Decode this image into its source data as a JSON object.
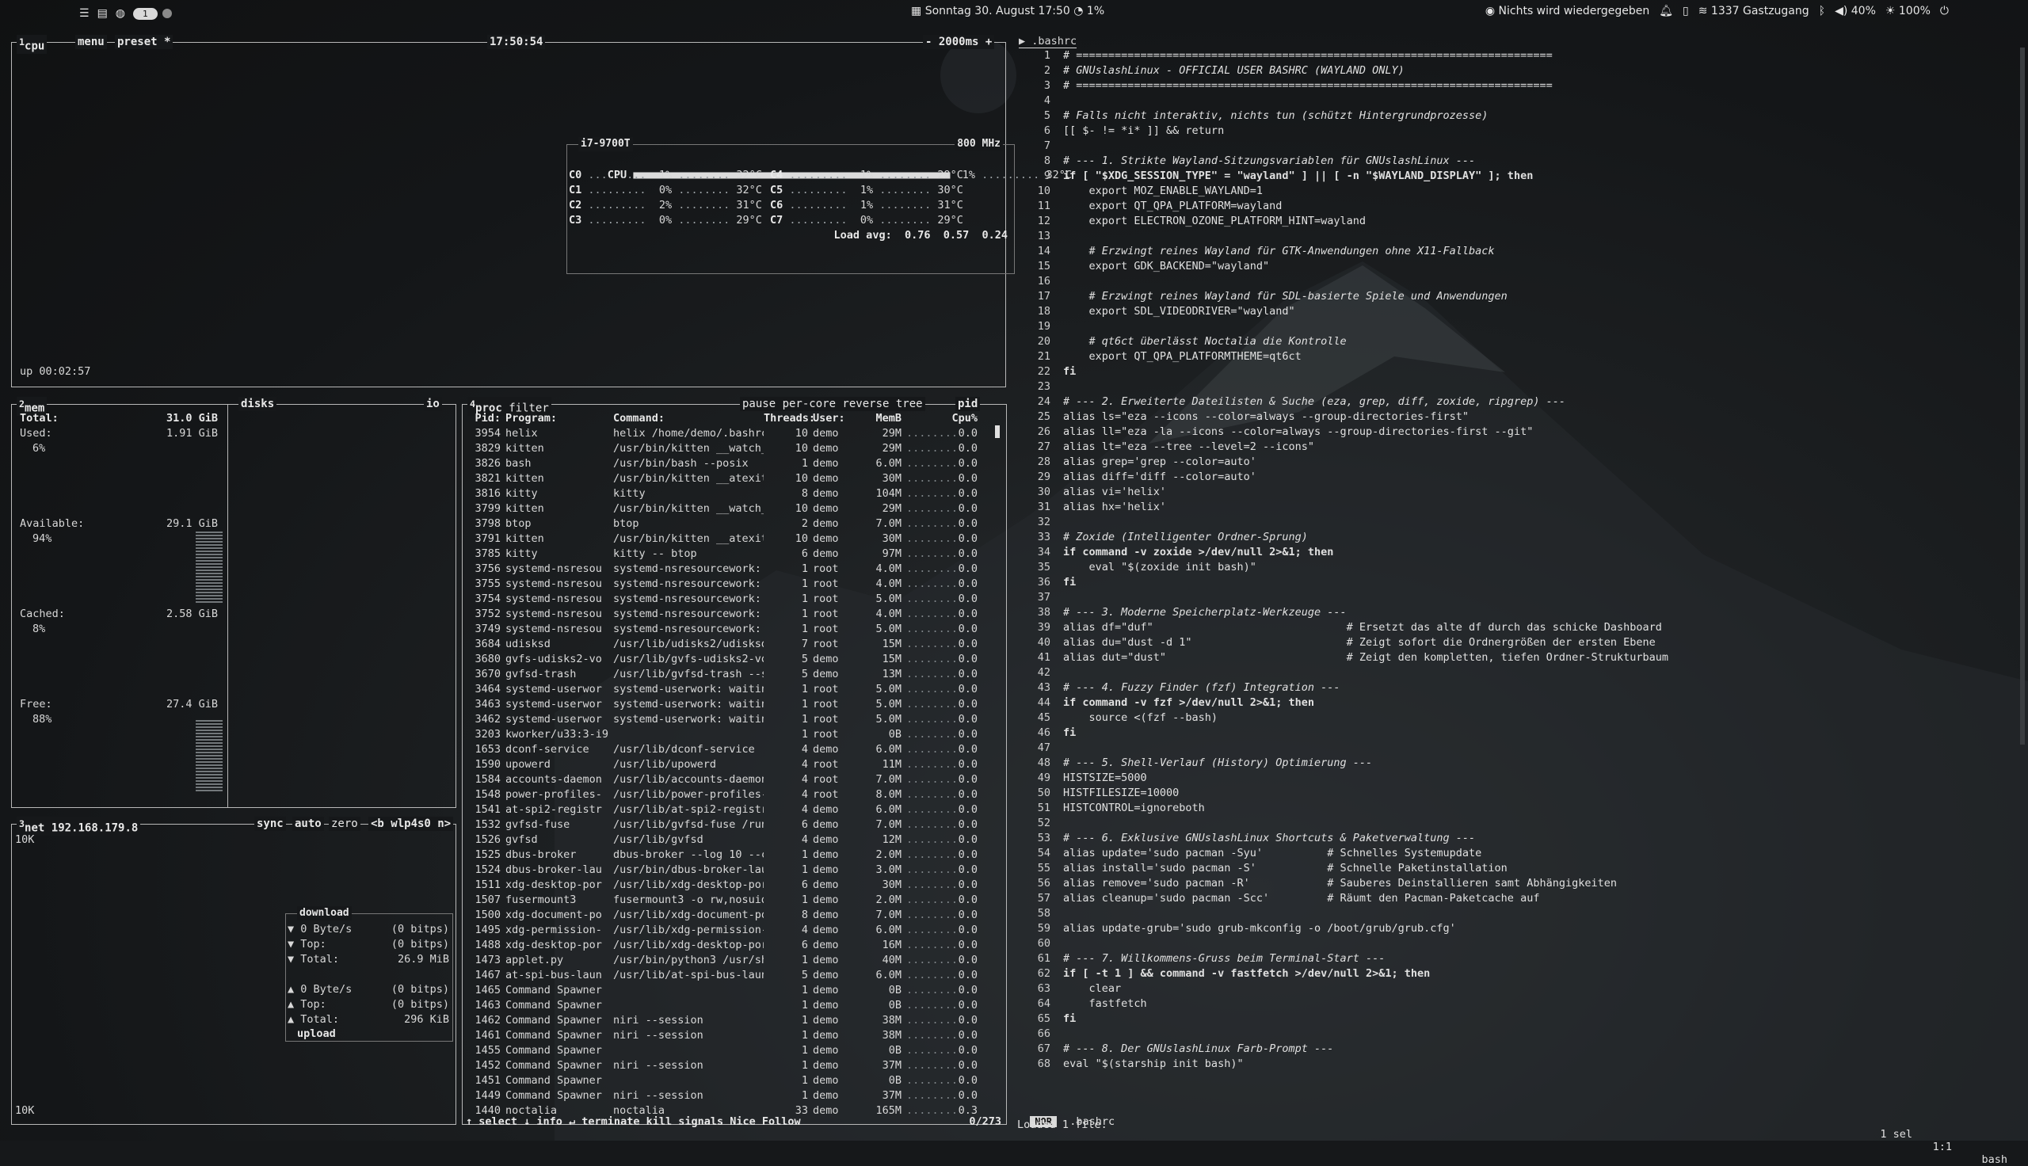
{
  "topbar": {
    "workspace": "1",
    "center": "Sonntag 30. August 17:50",
    "center_extra": "1%",
    "media": "Nichts wird wiedergegeben",
    "wifi": "1337 Gastzugang",
    "volume": "40%",
    "brightness": "100%"
  },
  "cpu": {
    "title": "cpu",
    "menu": "menu",
    "preset": "preset *",
    "clock": "17:50:54",
    "interval": "2000ms",
    "model": "i7-9700T",
    "freq": "800 MHz",
    "total": {
      "label": "CPU",
      "pct": "1%",
      "temp": "32°C"
    },
    "cores_left": [
      {
        "n": "C0",
        "pct": "1%",
        "temp": "32°C"
      },
      {
        "n": "C1",
        "pct": "0%",
        "temp": "32°C"
      },
      {
        "n": "C2",
        "pct": "2%",
        "temp": "31°C"
      },
      {
        "n": "C3",
        "pct": "0%",
        "temp": "29°C"
      }
    ],
    "cores_right": [
      {
        "n": "C4",
        "pct": "1%",
        "temp": "29°C"
      },
      {
        "n": "C5",
        "pct": "1%",
        "temp": "30°C"
      },
      {
        "n": "C6",
        "pct": "1%",
        "temp": "31°C"
      },
      {
        "n": "C7",
        "pct": "0%",
        "temp": "29°C"
      }
    ],
    "load": "Load avg:  0.76  0.57  0.24",
    "uptime": "up 00:02:57"
  },
  "mem": {
    "title": "mem",
    "disks": "disks",
    "io": "io",
    "total_label": "Total:",
    "total": "31.0 GiB",
    "used_label": "Used:",
    "used": "1.91 GiB",
    "used_pct": "6%",
    "avail_label": "Available:",
    "avail": "29.1 GiB",
    "avail_pct": "94%",
    "cached_label": "Cached:",
    "cached": "2.58 GiB",
    "cached_pct": "8%",
    "free_label": "Free:",
    "free": "27.4 GiB",
    "free_pct": "88%"
  },
  "net": {
    "title": "net",
    "ip": "192.168.179.8",
    "sync": "sync",
    "auto": "auto",
    "zero": "zero",
    "iface": "<b wlp4s0 n>",
    "scale_top": "10K",
    "scale_bottom": "10K",
    "download": "download",
    "upload": "upload",
    "dl_rate": "0 Byte/s",
    "dl_rate_bits": "(0 bitps)",
    "dl_top_label": "Top:",
    "dl_top": "(0 bitps)",
    "dl_total_label": "Total:",
    "dl_total": "26.9 MiB",
    "ul_rate": "0 Byte/s",
    "ul_rate_bits": "(0 bitps)",
    "ul_top_label": "Top:",
    "ul_top": "(0 bitps)",
    "ul_total_label": "Total:",
    "ul_total": "296 KiB"
  },
  "proc": {
    "title": "proc",
    "filter": "filter",
    "opts": "pause per-core reverse tree",
    "sort": "pid",
    "headers": {
      "pid": "Pid:",
      "prog": "Program:",
      "cmd": "Command:",
      "thr": "Threads:",
      "user": "User:",
      "mem": "MemB",
      "cpu": "Cpu%"
    },
    "rows": [
      [
        "3954",
        "helix",
        "helix /home/demo/.bashrc",
        "10",
        "demo",
        "29M",
        "0.0"
      ],
      [
        "3829",
        "kitten",
        "/usr/bin/kitten __watch_",
        "10",
        "demo",
        "29M",
        "0.0"
      ],
      [
        "3826",
        "bash",
        "/usr/bin/bash --posix",
        "1",
        "demo",
        "6.0M",
        "0.0"
      ],
      [
        "3821",
        "kitten",
        "/usr/bin/kitten __atexit",
        "10",
        "demo",
        "30M",
        "0.0"
      ],
      [
        "3816",
        "kitty",
        "kitty",
        "8",
        "demo",
        "104M",
        "0.0"
      ],
      [
        "3799",
        "kitten",
        "/usr/bin/kitten __watch_",
        "10",
        "demo",
        "29M",
        "0.0"
      ],
      [
        "3798",
        "btop",
        "btop",
        "2",
        "demo",
        "7.0M",
        "0.0"
      ],
      [
        "3791",
        "kitten",
        "/usr/bin/kitten __atexit",
        "10",
        "demo",
        "30M",
        "0.0"
      ],
      [
        "3785",
        "kitty",
        "kitty -- btop",
        "6",
        "demo",
        "97M",
        "0.0"
      ],
      [
        "3756",
        "systemd-nsresou",
        "systemd-nsresourcework:",
        "1",
        "root",
        "4.0M",
        "0.0"
      ],
      [
        "3755",
        "systemd-nsresou",
        "systemd-nsresourcework:",
        "1",
        "root",
        "4.0M",
        "0.0"
      ],
      [
        "3754",
        "systemd-nsresou",
        "systemd-nsresourcework:",
        "1",
        "root",
        "5.0M",
        "0.0"
      ],
      [
        "3752",
        "systemd-nsresou",
        "systemd-nsresourcework:",
        "1",
        "root",
        "4.0M",
        "0.0"
      ],
      [
        "3749",
        "systemd-nsresou",
        "systemd-nsresourcework:",
        "1",
        "root",
        "5.0M",
        "0.0"
      ],
      [
        "3684",
        "udisksd",
        "/usr/lib/udisks2/udisksd",
        "7",
        "root",
        "15M",
        "0.0"
      ],
      [
        "3680",
        "gvfs-udisks2-vo",
        "/usr/lib/gvfs-udisks2-vo",
        "5",
        "demo",
        "15M",
        "0.0"
      ],
      [
        "3670",
        "gvfsd-trash",
        "/usr/lib/gvfsd-trash --s",
        "5",
        "demo",
        "13M",
        "0.0"
      ],
      [
        "3464",
        "systemd-userwor",
        "systemd-userwork: waitin",
        "1",
        "root",
        "5.0M",
        "0.0"
      ],
      [
        "3463",
        "systemd-userwor",
        "systemd-userwork: waitin",
        "1",
        "root",
        "5.0M",
        "0.0"
      ],
      [
        "3462",
        "systemd-userwor",
        "systemd-userwork: waitin",
        "1",
        "root",
        "5.0M",
        "0.0"
      ],
      [
        "3203",
        "kworker/u33:3-i9",
        "",
        "1",
        "root",
        "0B",
        "0.0"
      ],
      [
        "1653",
        "dconf-service",
        "/usr/lib/dconf-service",
        "4",
        "demo",
        "6.0M",
        "0.0"
      ],
      [
        "1590",
        "upowerd",
        "/usr/lib/upowerd",
        "4",
        "root",
        "11M",
        "0.0"
      ],
      [
        "1584",
        "accounts-daemon",
        "/usr/lib/accounts-daemon",
        "4",
        "root",
        "7.0M",
        "0.0"
      ],
      [
        "1548",
        "power-profiles-",
        "/usr/lib/power-profiles-",
        "4",
        "root",
        "8.0M",
        "0.0"
      ],
      [
        "1541",
        "at-spi2-registr",
        "/usr/lib/at-spi2-registr",
        "4",
        "demo",
        "6.0M",
        "0.0"
      ],
      [
        "1532",
        "gvfsd-fuse",
        "/usr/lib/gvfsd-fuse /run",
        "6",
        "demo",
        "7.0M",
        "0.0"
      ],
      [
        "1526",
        "gvfsd",
        "/usr/lib/gvfsd",
        "4",
        "demo",
        "12M",
        "0.0"
      ],
      [
        "1525",
        "dbus-broker",
        "dbus-broker --log 10 --c",
        "1",
        "demo",
        "2.0M",
        "0.0"
      ],
      [
        "1524",
        "dbus-broker-lau",
        "/usr/bin/dbus-broker-lau",
        "1",
        "demo",
        "3.0M",
        "0.0"
      ],
      [
        "1511",
        "xdg-desktop-por",
        "/usr/lib/xdg-desktop-por",
        "6",
        "demo",
        "30M",
        "0.0"
      ],
      [
        "1507",
        "fusermount3",
        "fusermount3 -o rw,nosuid",
        "1",
        "demo",
        "2.0M",
        "0.0"
      ],
      [
        "1500",
        "xdg-document-po",
        "/usr/lib/xdg-document-po",
        "8",
        "demo",
        "7.0M",
        "0.0"
      ],
      [
        "1495",
        "xdg-permission-",
        "/usr/lib/xdg-permission-",
        "4",
        "demo",
        "6.0M",
        "0.0"
      ],
      [
        "1488",
        "xdg-desktop-por",
        "/usr/lib/xdg-desktop-por",
        "6",
        "demo",
        "16M",
        "0.0"
      ],
      [
        "1473",
        "applet.py",
        "/usr/bin/python3 /usr/sh",
        "1",
        "demo",
        "40M",
        "0.0"
      ],
      [
        "1467",
        "at-spi-bus-laun",
        "/usr/lib/at-spi-bus-laun",
        "5",
        "demo",
        "6.0M",
        "0.0"
      ],
      [
        "1465",
        "Command Spawner",
        "",
        "1",
        "demo",
        "0B",
        "0.0"
      ],
      [
        "1463",
        "Command Spawner",
        "",
        "1",
        "demo",
        "0B",
        "0.0"
      ],
      [
        "1462",
        "Command Spawner",
        "niri --session",
        "1",
        "demo",
        "38M",
        "0.0"
      ],
      [
        "1461",
        "Command Spawner",
        "niri --session",
        "1",
        "demo",
        "38M",
        "0.0"
      ],
      [
        "1455",
        "Command Spawner",
        "",
        "1",
        "demo",
        "0B",
        "0.0"
      ],
      [
        "1452",
        "Command Spawner",
        "niri --session",
        "1",
        "demo",
        "37M",
        "0.0"
      ],
      [
        "1451",
        "Command Spawner",
        "",
        "1",
        "demo",
        "0B",
        "0.0"
      ],
      [
        "1449",
        "Command Spawner",
        "niri --session",
        "1",
        "demo",
        "37M",
        "0.0"
      ],
      [
        "1440",
        "noctalia",
        "noctalia",
        "33",
        "demo",
        "165M",
        "0.3"
      ]
    ],
    "keys": "↑ select ↓ info ↵ terminate kill signals Nice Follow",
    "count": "0/273"
  },
  "editor": {
    "tab": ".bashrc",
    "mode": "NOR",
    "file": ".bashrc",
    "sel": "1 sel",
    "pos": "1:1",
    "lang": "bash",
    "message": "Loaded 1 file.",
    "lines": [
      "# ==========================================================================",
      "# GNUslashLinux - OFFICIAL USER BASHRC (WAYLAND ONLY)",
      "# ==========================================================================",
      "",
      "# Falls nicht interaktiv, nichts tun (schützt Hintergrundprozesse)",
      "[[ $- != *i* ]] && return",
      "",
      "# --- 1. Strikte Wayland-Sitzungsvariablen für GNUslashLinux ---",
      "if [ \"$XDG_SESSION_TYPE\" = \"wayland\" ] || [ -n \"$WAYLAND_DISPLAY\" ]; then",
      "    export MOZ_ENABLE_WAYLAND=1",
      "    export QT_QPA_PLATFORM=wayland",
      "    export ELECTRON_OZONE_PLATFORM_HINT=wayland",
      "",
      "    # Erzwingt reines Wayland für GTK-Anwendungen ohne X11-Fallback",
      "    export GDK_BACKEND=\"wayland\"",
      "",
      "    # Erzwingt reines Wayland für SDL-basierte Spiele und Anwendungen",
      "    export SDL_VIDEODRIVER=\"wayland\"",
      "",
      "    # qt6ct überlässt Noctalia die Kontrolle",
      "    export QT_QPA_PLATFORMTHEME=qt6ct",
      "fi",
      "",
      "# --- 2. Erweiterte Dateilisten & Suche (eza, grep, diff, zoxide, ripgrep) ---",
      "alias ls=\"eza --icons --color=always --group-directories-first\"",
      "alias ll=\"eza -la --icons --color=always --group-directories-first --git\"",
      "alias lt=\"eza --tree --level=2 --icons\"",
      "alias grep='grep --color=auto'",
      "alias diff='diff --color=auto'",
      "alias vi='helix'",
      "alias hx='helix'",
      "",
      "# Zoxide (Intelligenter Ordner-Sprung)",
      "if command -v zoxide >/dev/null 2>&1; then",
      "    eval \"$(zoxide init bash)\"",
      "fi",
      "",
      "# --- 3. Moderne Speicherplatz-Werkzeuge ---",
      "alias df=\"duf\"                              # Ersetzt das alte df durch das schicke Dashboard",
      "alias du=\"dust -d 1\"                        # Zeigt sofort die Ordnergrößen der ersten Ebene",
      "alias dut=\"dust\"                            # Zeigt den kompletten, tiefen Ordner-Strukturbaum",
      "",
      "# --- 4. Fuzzy Finder (fzf) Integration ---",
      "if command -v fzf >/dev/null 2>&1; then",
      "    source <(fzf --bash)",
      "fi",
      "",
      "# --- 5. Shell-Verlauf (History) Optimierung ---",
      "HISTSIZE=5000",
      "HISTFILESIZE=10000",
      "HISTCONTROL=ignoreboth",
      "",
      "# --- 6. Exklusive GNUslashLinux Shortcuts & Paketverwaltung ---",
      "alias update='sudo pacman -Syu'          # Schnelles Systemupdate",
      "alias install='sudo pacman -S'           # Schnelle Paketinstallation",
      "alias remove='sudo pacman -R'            # Sauberes Deinstallieren samt Abhängigkeiten",
      "alias cleanup='sudo pacman -Scc'         # Räumt den Pacman-Paketcache auf",
      "",
      "alias update-grub='sudo grub-mkconfig -o /boot/grub/grub.cfg'",
      "",
      "# --- 7. Willkommens-Gruss beim Terminal-Start ---",
      "if [ -t 1 ] && command -v fastfetch >/dev/null 2>&1; then",
      "    clear",
      "    fastfetch",
      "fi",
      "",
      "# --- 8. Der GNUslashLinux Farb-Prompt ---",
      "eval \"$(starship init bash)\""
    ]
  }
}
